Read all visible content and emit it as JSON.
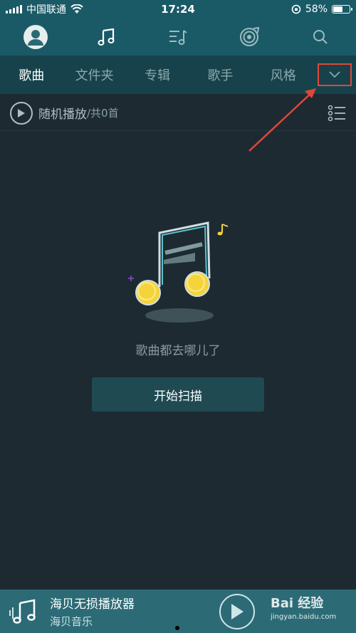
{
  "status": {
    "carrier": "中国联通",
    "time": "17:24",
    "battery_text": "58%",
    "battery_level": 0.58
  },
  "top_nav": {
    "icons": [
      "profile-icon",
      "music-note-icon",
      "playlist-icon",
      "radio-icon",
      "search-icon"
    ]
  },
  "tabs": {
    "items": [
      "歌曲",
      "文件夹",
      "专辑",
      "歌手",
      "风格"
    ],
    "active": "歌曲",
    "dropdown_icon": "chevron-down-icon"
  },
  "play_row": {
    "label": "随机播放",
    "count": "/共0首"
  },
  "empty_state": {
    "message": "歌曲都去哪儿了",
    "button": "开始扫描"
  },
  "mini_player": {
    "title": "海贝无损播放器",
    "subtitle": "海贝音乐"
  },
  "watermark": {
    "main": "Bai 经验",
    "sub": "jingyan.baidu.com"
  },
  "colors": {
    "header": "#1a5a66",
    "tabs_bg": "#17424b",
    "body_bg": "#1d2a31",
    "accent_red": "#e0473a",
    "note_yellow": "#f5d33b"
  }
}
